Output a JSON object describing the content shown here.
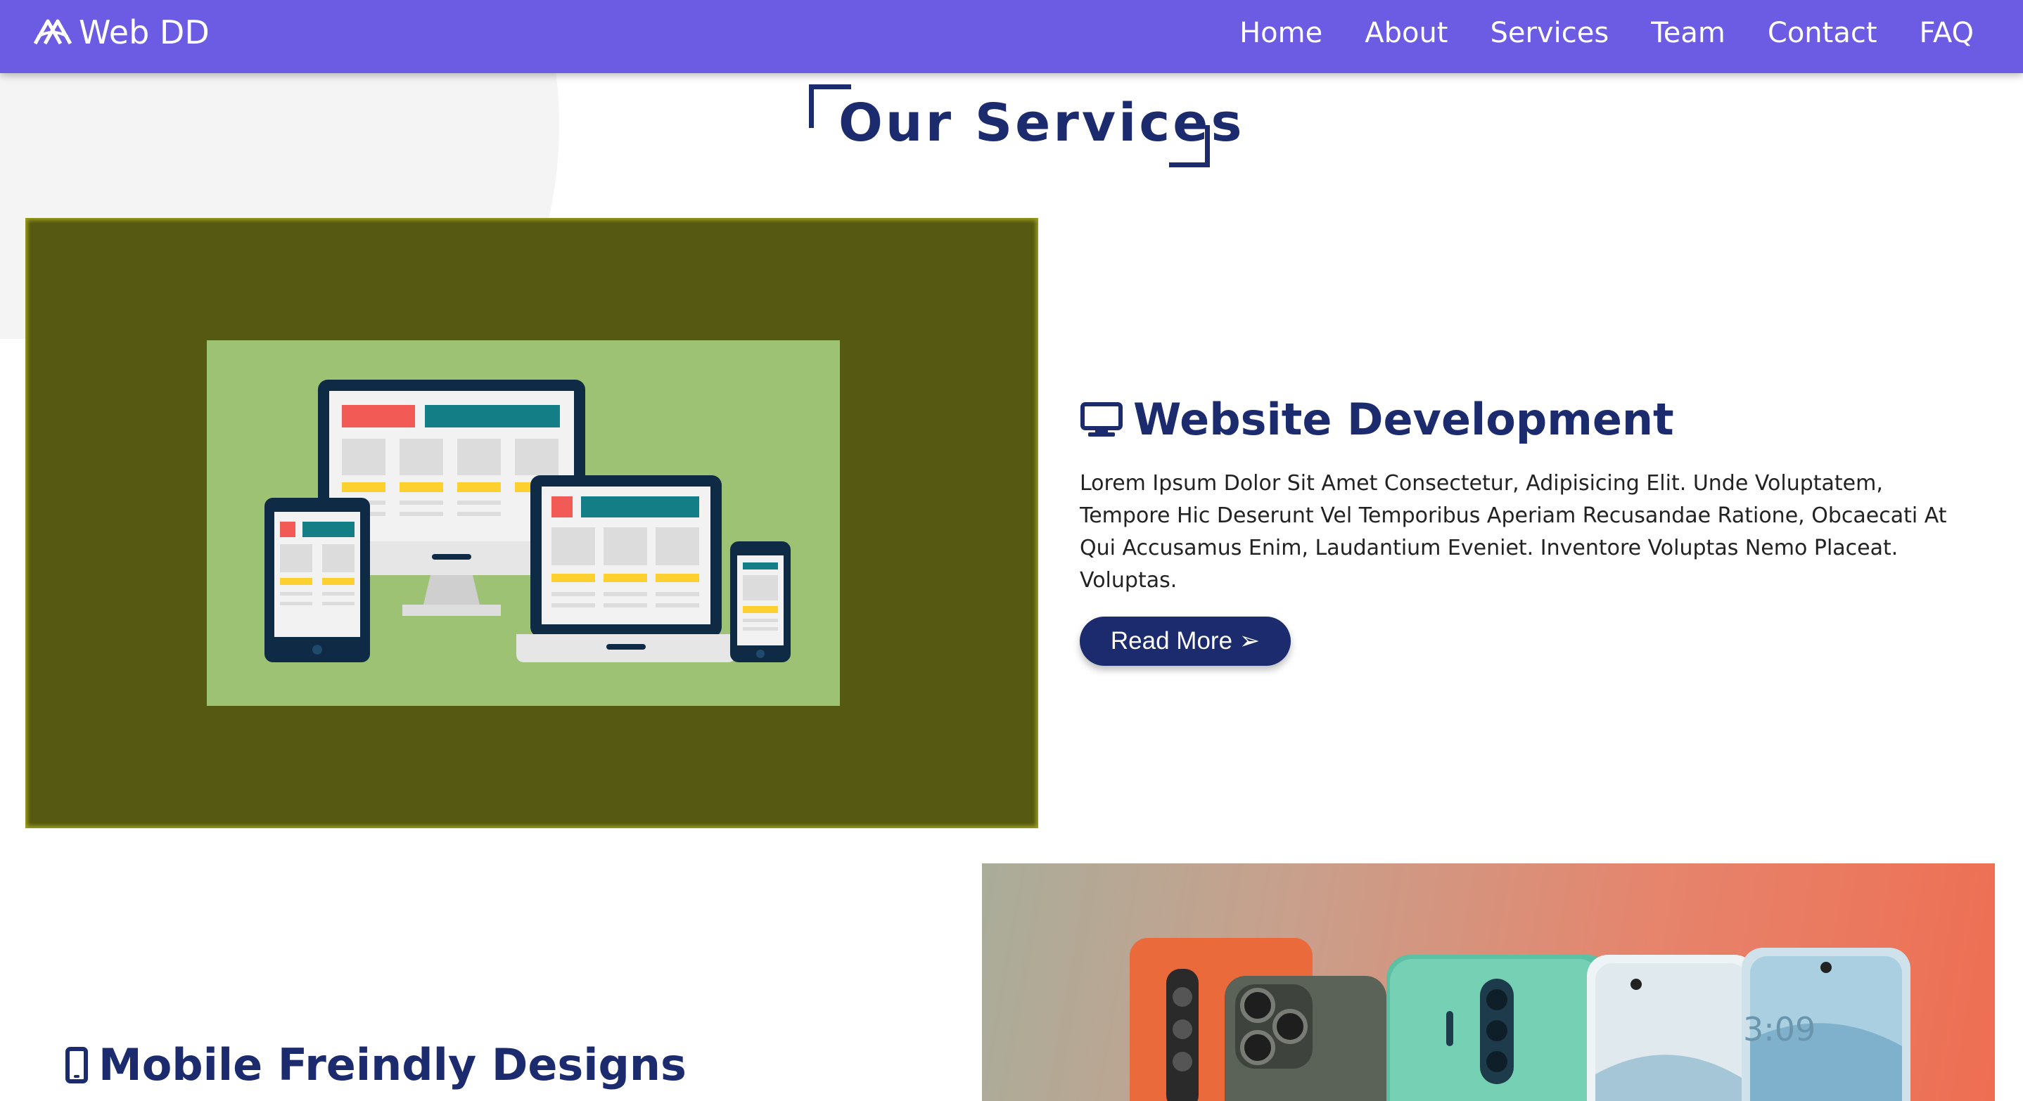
{
  "brand": {
    "name": "Web DD",
    "icon": "logo-icon"
  },
  "nav": {
    "items": [
      {
        "label": "Home"
      },
      {
        "label": "About"
      },
      {
        "label": "Services"
      },
      {
        "label": "Team"
      },
      {
        "label": "Contact"
      },
      {
        "label": "FAQ"
      }
    ]
  },
  "section": {
    "title": "Our Services"
  },
  "services": [
    {
      "icon": "desktop-icon",
      "title": "Website Development",
      "description": "Lorem Ipsum Dolor Sit Amet Consectetur, Adipisicing Elit. Unde Voluptatem, Tempore Hic Deserunt Vel Temporibus Aperiam Recusandae Ratione, Obcaecati At Qui Accusamus Enim, Laudantium Eveniet. Inventore Voluptas Nemo Placeat. Voluptas.",
      "button": "Read More ➢"
    },
    {
      "icon": "mobile-icon",
      "title": "Mobile Freindly Designs"
    }
  ],
  "colors": {
    "navbar": "#6c5ce3",
    "heading": "#1b2b6e",
    "button": "#1b2b6e",
    "image_bg": "#565911",
    "illustration_bg": "#9ec273"
  }
}
